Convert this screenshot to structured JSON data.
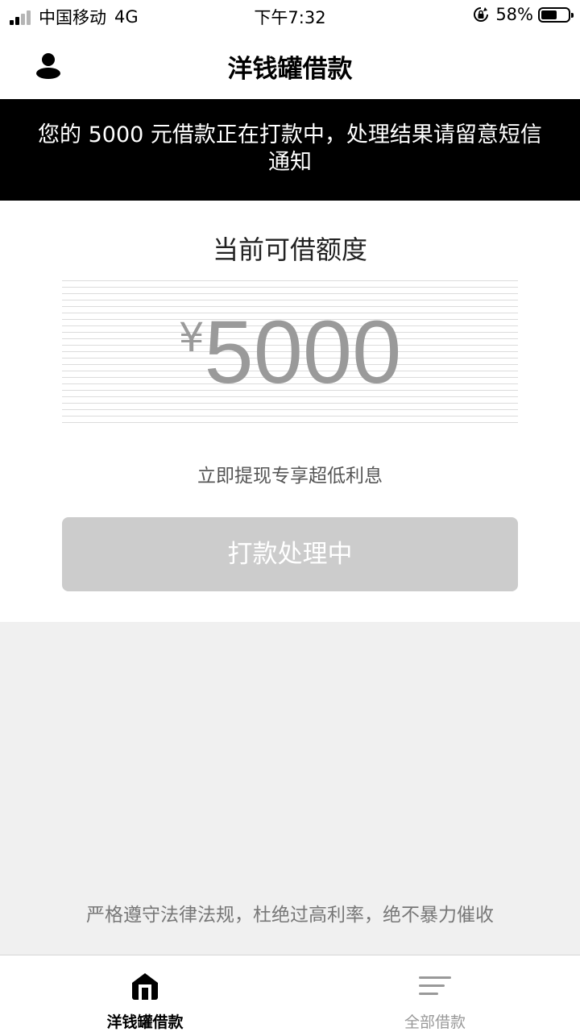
{
  "status_bar": {
    "carrier": "中国移动",
    "network": "4G",
    "time": "下午7:32",
    "battery_percent": "58%",
    "battery_level": 0.58
  },
  "nav": {
    "title": "洋钱罐借款",
    "icon": "user-icon"
  },
  "notice": {
    "text": "您的 5000 元借款正在打款中，处理结果请留意短信通知"
  },
  "quota": {
    "label": "当前可借额度",
    "currency": "¥",
    "amount": "5000",
    "subtext": "立即提现专享超低利息",
    "button_label": "打款处理中"
  },
  "footer": {
    "note": "严格遵守法律法规，杜绝过高利率，绝不暴力催收"
  },
  "tabs": [
    {
      "label": "洋钱罐借款",
      "icon": "home-icon",
      "active": true
    },
    {
      "label": "全部借款",
      "icon": "list-icon",
      "active": false
    }
  ],
  "colors": {
    "notice_bg": "#000000",
    "amount": "#9a9a9a",
    "button_disabled": "#cccccc",
    "page_bg": "#f0f0f0"
  }
}
